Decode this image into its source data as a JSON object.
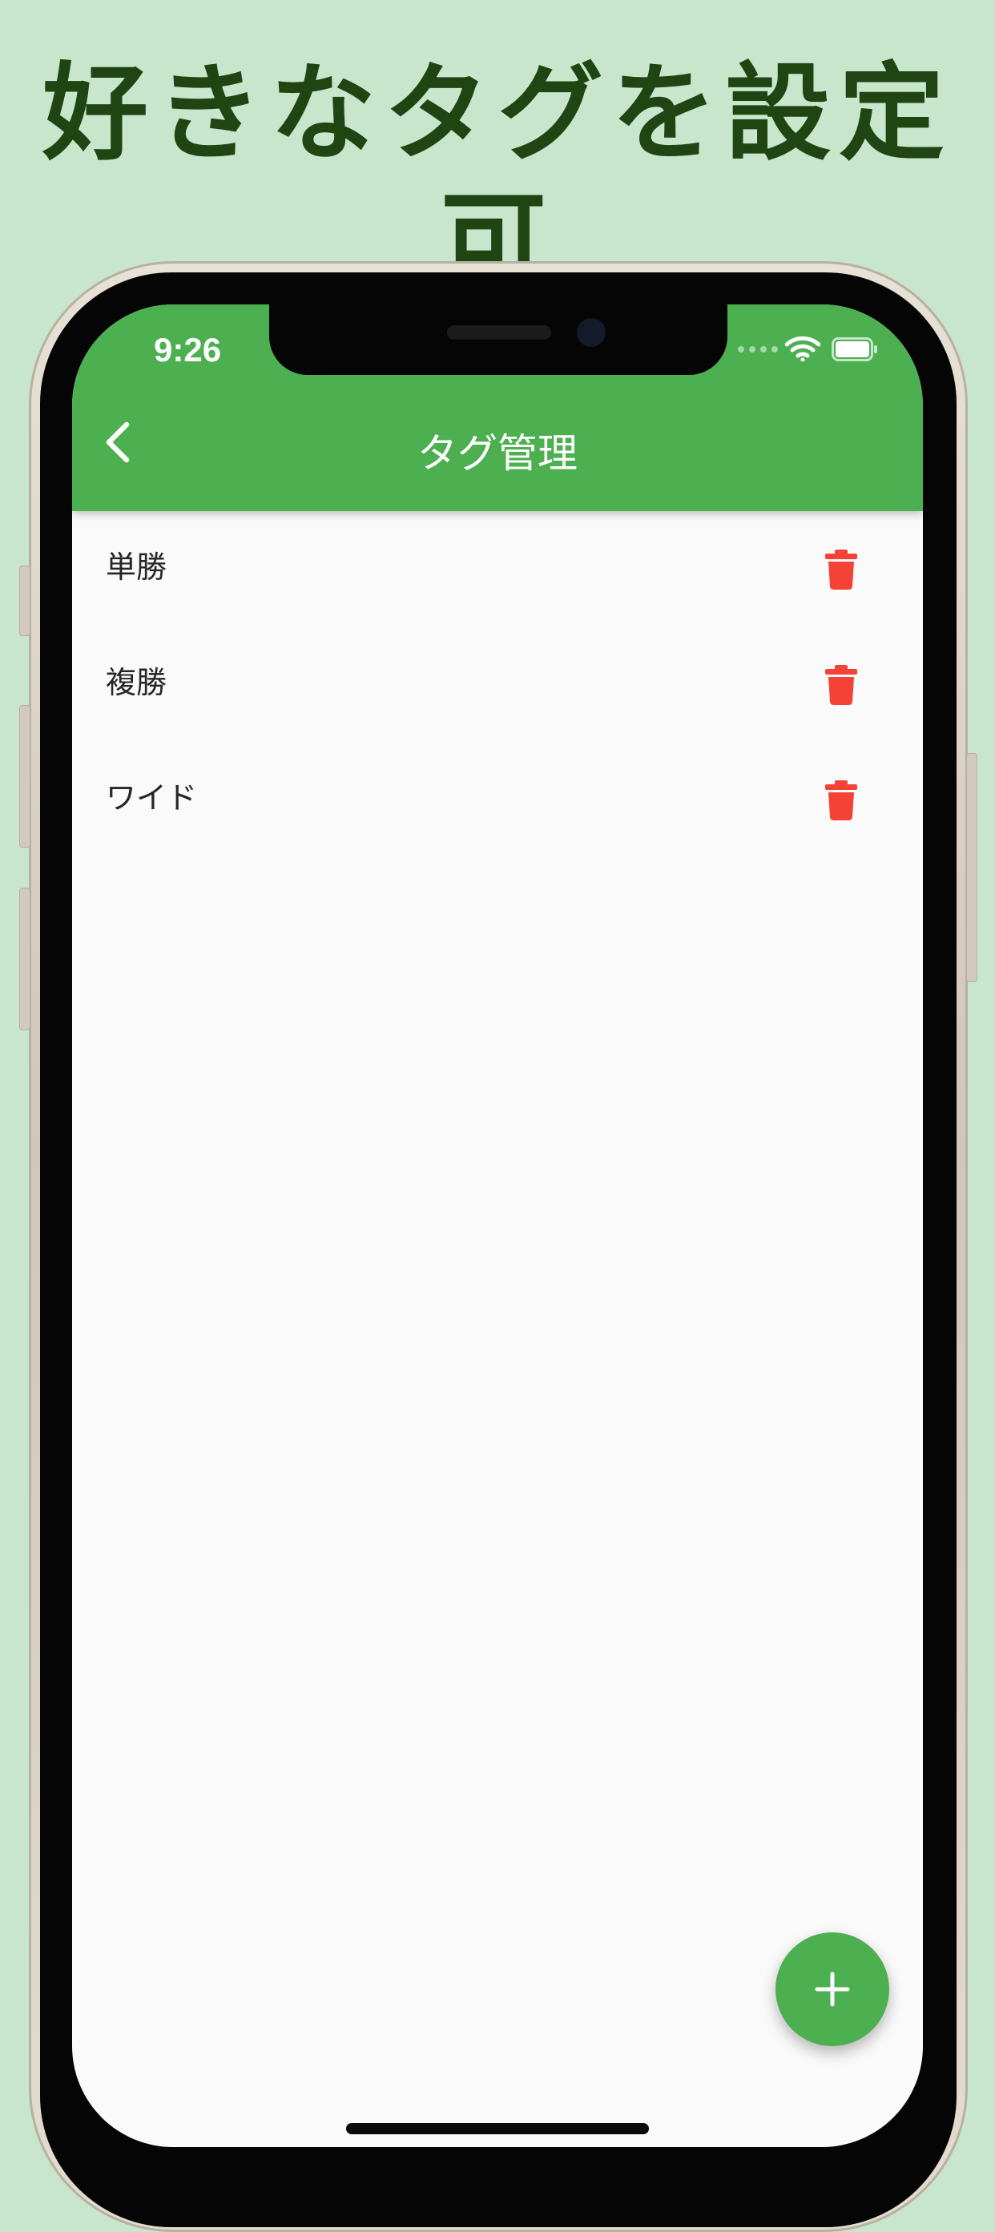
{
  "headline": "好きなタグを設定可",
  "status_bar": {
    "time": "9:26",
    "wifi_icon": "wifi-icon",
    "battery_icon": "battery-icon"
  },
  "app_bar": {
    "title": "タグ管理",
    "back_icon": "chevron-left-icon",
    "background": "#4caf50"
  },
  "tags": [
    {
      "label": "単勝",
      "delete_icon": "trash-icon"
    },
    {
      "label": "複勝",
      "delete_icon": "trash-icon"
    },
    {
      "label": "ワイド",
      "delete_icon": "trash-icon"
    }
  ],
  "fab": {
    "icon": "plus-icon",
    "color": "#4caf50"
  },
  "colors": {
    "page_background": "#c8e6cb",
    "headline": "#1f4513",
    "delete": "#f44336",
    "screen_background": "#fafafa"
  }
}
